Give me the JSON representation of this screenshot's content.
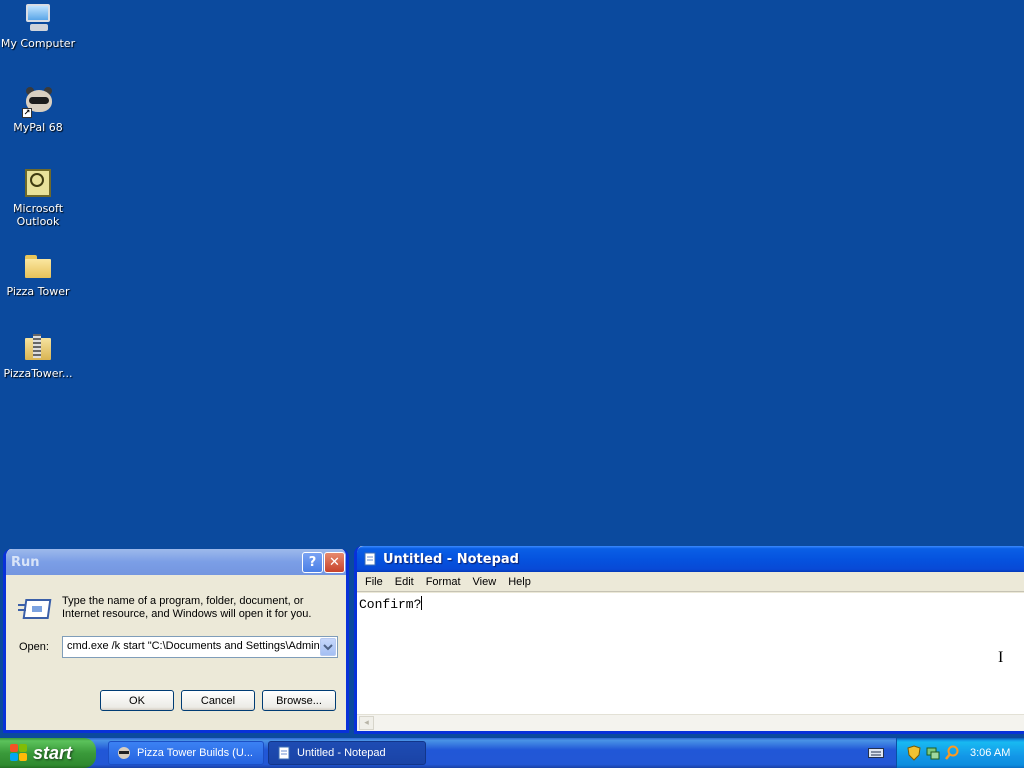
{
  "desktop": {
    "icons": [
      {
        "label": "My Computer"
      },
      {
        "label": "MyPal 68"
      },
      {
        "label": "Microsoft Outlook"
      },
      {
        "label": "Pizza Tower"
      },
      {
        "label": "PizzaTower..."
      }
    ]
  },
  "run_dialog": {
    "title": "Run",
    "help_glyph": "?",
    "close_glyph": "✕",
    "description": "Type the name of a program, folder, document, or Internet resource, and Windows will open it for you.",
    "open_label": "Open:",
    "open_value": "cmd.exe /k start \"C:\\Documents and Settings\\Admin",
    "ok_label": "OK",
    "cancel_label": "Cancel",
    "browse_label": "Browse..."
  },
  "notepad": {
    "title": "Untitled - Notepad",
    "menu": [
      "File",
      "Edit",
      "Format",
      "View",
      "Help"
    ],
    "content": "Confirm?",
    "scroll_arrow": "◂"
  },
  "taskbar": {
    "start_label": "start",
    "tasks": [
      {
        "label": "Pizza Tower Builds (U..."
      },
      {
        "label": "Untitled - Notepad"
      }
    ],
    "clock": "3:06 AM",
    "colors": {
      "start": "#3a9a3a",
      "taskbar": "#2257d5",
      "tray": "#1397e8"
    }
  },
  "cursor_glyph": "I"
}
